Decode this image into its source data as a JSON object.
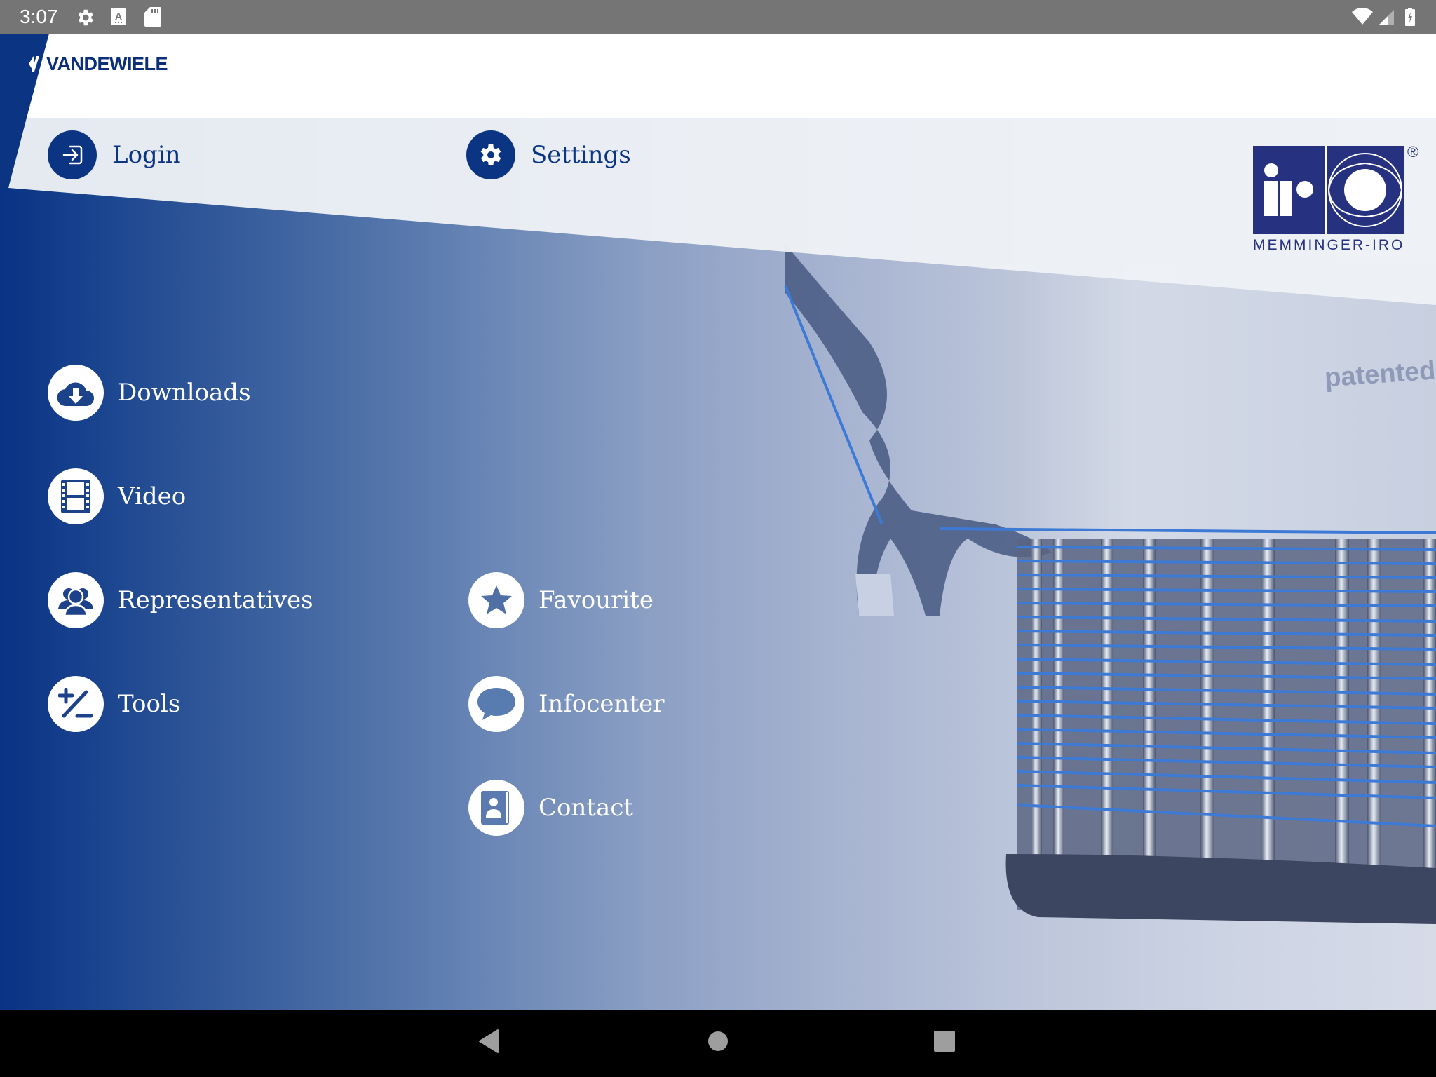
{
  "status_bar": {
    "time": "3:07",
    "left_icons": [
      "settings-gear-icon",
      "keyboard-a-icon",
      "sd-card-icon"
    ],
    "right_icons": [
      "wifi-icon",
      "cellular-signal-icon",
      "battery-charging-icon"
    ]
  },
  "header": {
    "brand": "VANDEWIELE",
    "partner_logo": {
      "name": "iro",
      "subtitle": "MEMMINGER-IRO",
      "registered": "®"
    },
    "actions": [
      {
        "label": "Login",
        "icon": "login-icon"
      },
      {
        "label": "Settings",
        "icon": "gear-icon"
      }
    ]
  },
  "menu": {
    "left_column": [
      {
        "label": "Downloads",
        "icon": "cloud-download-icon"
      },
      {
        "label": "Video",
        "icon": "film-icon"
      },
      {
        "label": "Representatives",
        "icon": "users-icon"
      },
      {
        "label": "Tools",
        "icon": "plus-minus-icon"
      }
    ],
    "right_column": [
      {
        "label": "Favourite",
        "icon": "star-icon"
      },
      {
        "label": "Infocenter",
        "icon": "chat-bubble-icon"
      },
      {
        "label": "Contact",
        "icon": "contact-book-icon"
      }
    ]
  },
  "background_image": {
    "description": "yarn feeder with blue yarn wound on drum",
    "printed_text": "patented"
  },
  "nav_bar": {
    "buttons": [
      "back",
      "home",
      "recents"
    ]
  },
  "colors": {
    "brand_blue": "#0b3582",
    "iro_blue": "#26327f",
    "yarn_blue": "#3d7ad6",
    "status_bar": "#757575"
  }
}
